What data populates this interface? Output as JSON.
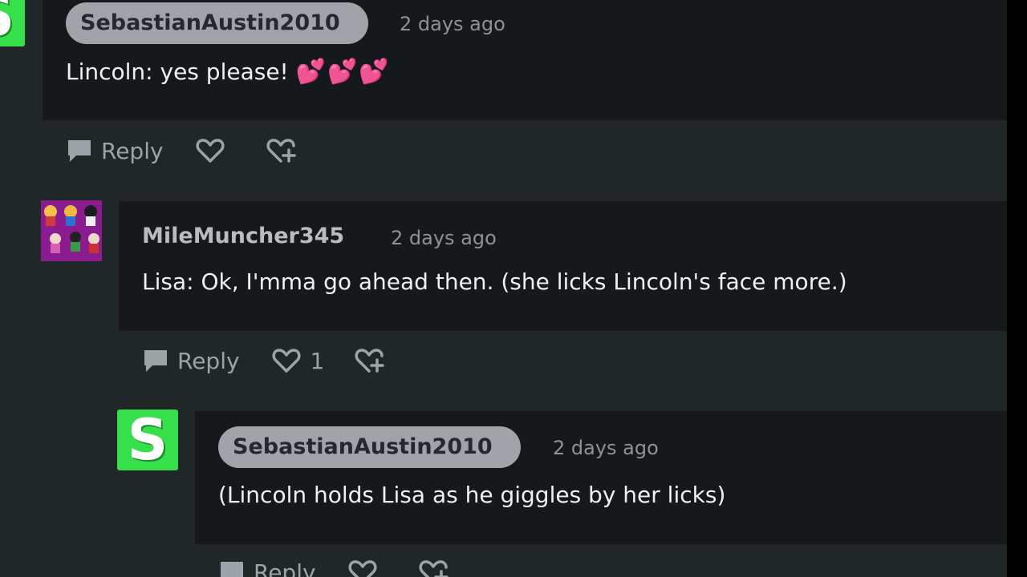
{
  "comments": [
    {
      "username": "SebastianAustin2010",
      "timestamp": "2 days ago",
      "text": "Lincoln: yes please!",
      "emoji": "💕💕💕",
      "actions": {
        "reply_label": "Reply",
        "like_count": ""
      }
    },
    {
      "username": "MileMuncher345",
      "timestamp": "2 days ago",
      "text": "Lisa: Ok, I'mma go ahead then. (she licks Lincoln's face more.)",
      "actions": {
        "reply_label": "Reply",
        "like_count": "1"
      }
    },
    {
      "username": "SebastianAustin2010",
      "timestamp": "2 days ago",
      "text": "(Lincoln holds Lisa as he giggles by her licks)",
      "actions": {
        "reply_label": "Reply",
        "like_count": ""
      }
    }
  ],
  "avatars": {
    "sebastian_letter": "S"
  },
  "colors": {
    "background": "#212629",
    "card": "#15191c",
    "pill": "#a0a3a7",
    "avatar_green": "#35e04a",
    "heart_emoji": "#ff3fa9"
  },
  "icons": [
    "reply-icon",
    "heart-icon",
    "share-icon"
  ]
}
